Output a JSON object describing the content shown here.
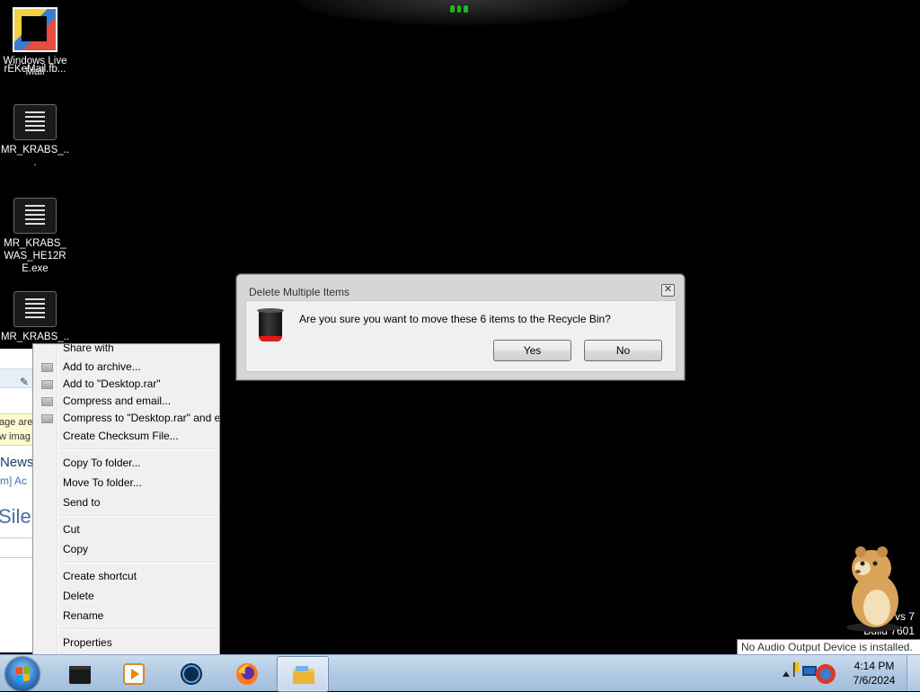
{
  "desktop": {
    "icons": [
      {
        "label": "Windows Live\nMail",
        "overlay_label": "rEKeMail.fb..."
      },
      {
        "label": "MR_KRABS_..."
      },
      {
        "label": "MR_KRABS_WAS_HE12RE.exe"
      },
      {
        "label": "MR_KRABS_..."
      }
    ]
  },
  "background_window": {
    "notice_line1": "age are",
    "notice_line2": "w imag",
    "news": "News",
    "links": "m]   Ac",
    "big_text": "Siler"
  },
  "context_menu": {
    "items": [
      {
        "label": "Share with",
        "icon": false
      },
      {
        "label": "Add to archive...",
        "icon": true
      },
      {
        "label": "Add to \"Desktop.rar\"",
        "icon": true
      },
      {
        "label": "Compress and email...",
        "icon": true
      },
      {
        "label": "Compress to \"Desktop.rar\" and email",
        "icon": true
      },
      {
        "label": "Create Checksum File...",
        "icon": false
      },
      {
        "label": "Copy To folder...",
        "icon": false
      },
      {
        "label": "Move To folder...",
        "icon": false
      },
      {
        "label": "Send to",
        "icon": false
      },
      {
        "label": "Cut",
        "icon": false
      },
      {
        "label": "Copy",
        "icon": false
      },
      {
        "label": "Create shortcut",
        "icon": false
      },
      {
        "label": "Delete",
        "icon": false
      },
      {
        "label": "Rename",
        "icon": false
      },
      {
        "label": "Properties",
        "icon": false
      }
    ]
  },
  "dialog": {
    "title": "Delete Multiple Items",
    "message": "Are you sure you want to move these 6 items to the Recycle Bin?",
    "yes_label": "Yes",
    "no_label": "No",
    "close_glyph": "✕"
  },
  "gadget": {
    "line1": "vs 7",
    "line2": "Build 7601"
  },
  "tooltip": {
    "text": "No Audio Output Device is installed."
  },
  "taskbar": {
    "pinned": [
      "terminal-icon",
      "media-player-icon",
      "browser-globe-icon",
      "firefox-icon",
      "explorer-icon"
    ],
    "time": "4:14 PM",
    "date": "7/6/2024"
  },
  "colors": {
    "desktop_bg": "#000000",
    "taskbar": "#b2c9e3",
    "dialog_bg": "#d6d6d6",
    "recycle_accent": "#e41a1a"
  }
}
